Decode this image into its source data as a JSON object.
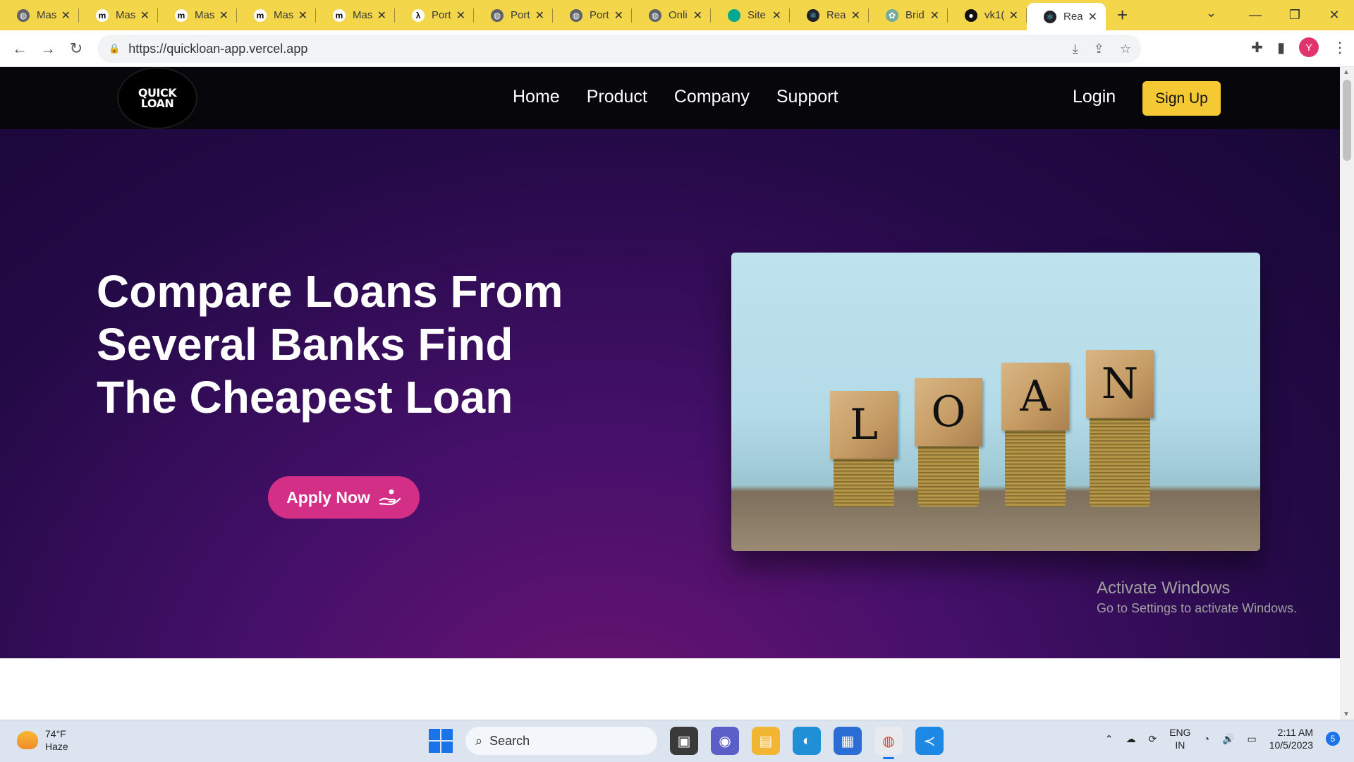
{
  "browser": {
    "tabs": [
      {
        "title": "Mas",
        "icon": "globe-icon",
        "active": false
      },
      {
        "title": "Mas",
        "icon": "medium-icon",
        "active": false
      },
      {
        "title": "Mas",
        "icon": "medium-icon",
        "active": false
      },
      {
        "title": "Mas",
        "icon": "medium-icon",
        "active": false
      },
      {
        "title": "Mas",
        "icon": "medium-icon",
        "active": false
      },
      {
        "title": "Port",
        "icon": "lambda-icon",
        "active": false
      },
      {
        "title": "Port",
        "icon": "globe-icon",
        "active": false
      },
      {
        "title": "Port",
        "icon": "globe-icon",
        "active": false
      },
      {
        "title": "Onli",
        "icon": "globe-icon",
        "active": false
      },
      {
        "title": "Site",
        "icon": "diamond-icon",
        "active": false
      },
      {
        "title": "Rea",
        "icon": "react-icon",
        "active": false
      },
      {
        "title": "Brid",
        "icon": "openai-icon",
        "active": false
      },
      {
        "title": "vk1(",
        "icon": "github-icon",
        "active": false
      },
      {
        "title": "Rea",
        "icon": "react-icon",
        "active": true
      }
    ],
    "url": "https://quickloan-app.vercel.app",
    "avatar_letter": "Y"
  },
  "site": {
    "logo_line1": "QUICK",
    "logo_line2": "LOAN",
    "menu": [
      "Home",
      "Product",
      "Company",
      "Support"
    ],
    "login": "Login",
    "signup": "Sign Up",
    "hero_title": "Compare Loans From Several Banks Find The Cheapest Loan",
    "apply_button": "Apply Now",
    "image_letters": [
      "L",
      "O",
      "A",
      "N"
    ]
  },
  "watermark": {
    "line1": "Activate Windows",
    "line2": "Go to Settings to activate Windows."
  },
  "taskbar": {
    "weather_temp": "74°F",
    "weather_desc": "Haze",
    "search_placeholder": "Search",
    "lang_line1": "ENG",
    "lang_line2": "IN",
    "time": "2:11 AM",
    "date": "10/5/2023",
    "notification_count": "5"
  }
}
